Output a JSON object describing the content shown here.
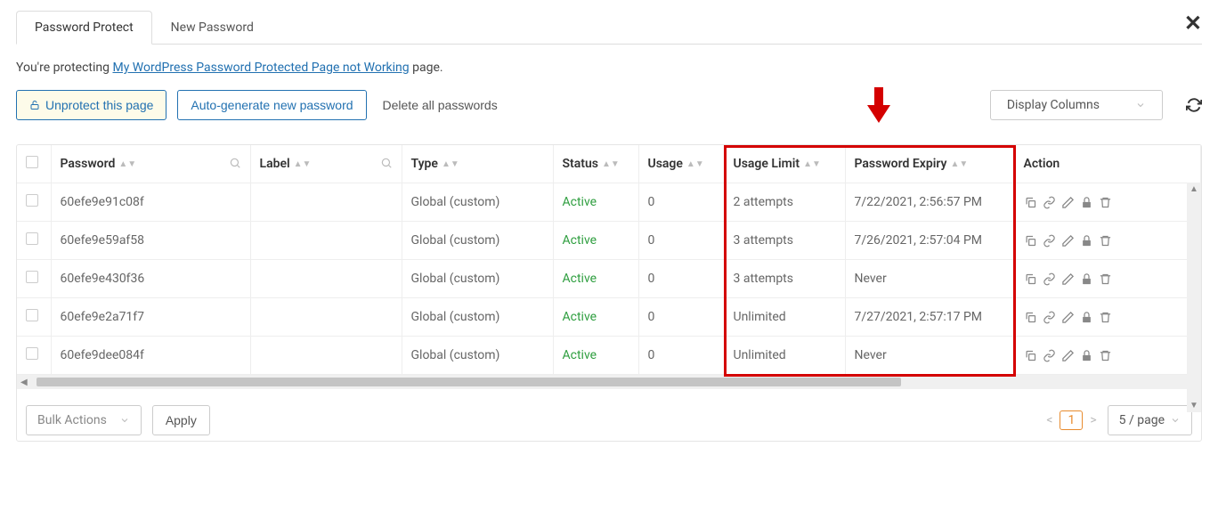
{
  "tabs": {
    "protect": "Password Protect",
    "new_pwd": "New Password"
  },
  "protecting_prefix": "You're protecting ",
  "protecting_link": "My WordPress Password Protected Page not Working",
  "protecting_suffix": " page.",
  "buttons": {
    "unprotect": "Unprotect this page",
    "autogen": "Auto-generate new password",
    "delete_all": "Delete all passwords",
    "display_cols": "Display Columns",
    "bulk": "Bulk Actions",
    "apply": "Apply"
  },
  "columns": {
    "password": "Password",
    "label": "Label",
    "type": "Type",
    "status": "Status",
    "usage": "Usage",
    "usage_limit": "Usage Limit",
    "expiry": "Password Expiry",
    "action": "Action"
  },
  "rows": [
    {
      "password": "60efe9e91c08f",
      "label": "",
      "type": "Global (custom)",
      "status": "Active",
      "usage": "0",
      "usage_limit": "2 attempts",
      "expiry": "7/22/2021, 2:56:57 PM"
    },
    {
      "password": "60efe9e59af58",
      "label": "",
      "type": "Global (custom)",
      "status": "Active",
      "usage": "0",
      "usage_limit": "3 attempts",
      "expiry": "7/26/2021, 2:57:04 PM"
    },
    {
      "password": "60efe9e430f36",
      "label": "",
      "type": "Global (custom)",
      "status": "Active",
      "usage": "0",
      "usage_limit": "3 attempts",
      "expiry": "Never"
    },
    {
      "password": "60efe9e2a71f7",
      "label": "",
      "type": "Global (custom)",
      "status": "Active",
      "usage": "0",
      "usage_limit": "Unlimited",
      "expiry": "7/27/2021, 2:57:17 PM"
    },
    {
      "password": "60efe9dee084f",
      "label": "",
      "type": "Global (custom)",
      "status": "Active",
      "usage": "0",
      "usage_limit": "Unlimited",
      "expiry": "Never"
    }
  ],
  "pager": {
    "current": "1",
    "per_page": "5 / page"
  }
}
